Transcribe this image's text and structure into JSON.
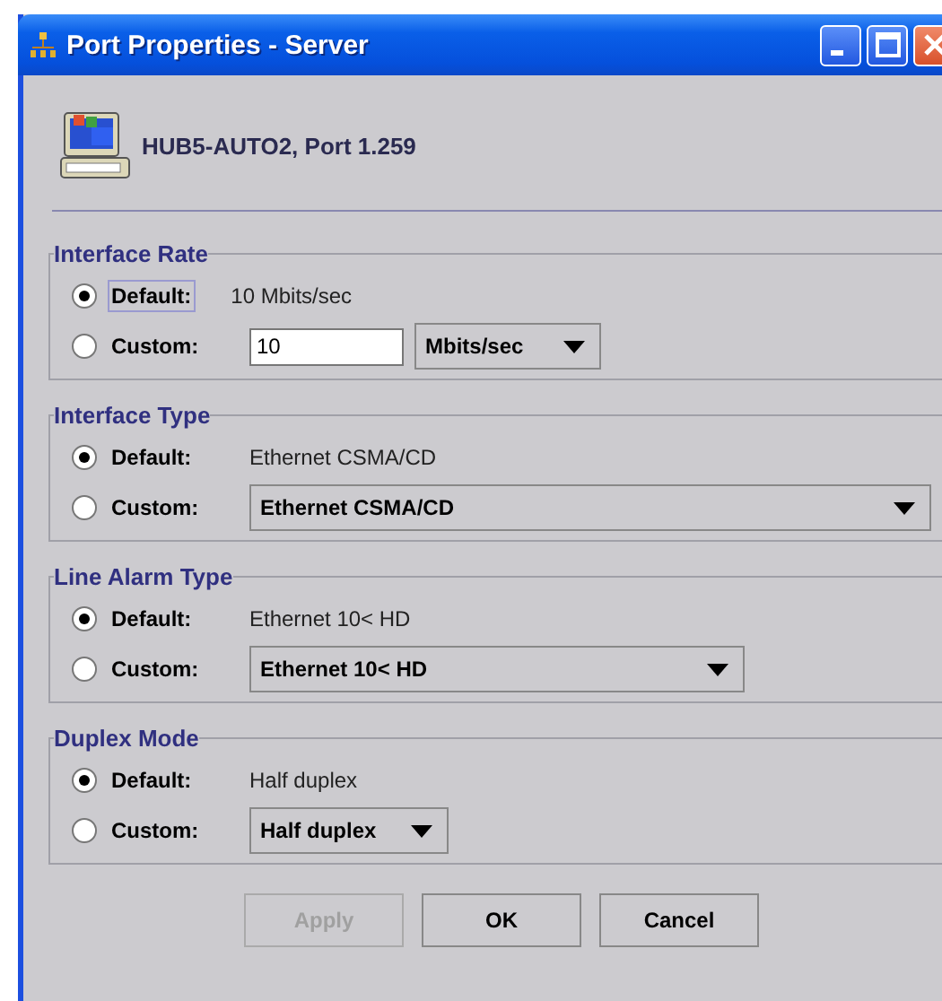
{
  "window": {
    "title": "Port Properties - Server"
  },
  "header": {
    "text": "HUB5-AUTO2, Port 1.259"
  },
  "sections": [
    {
      "title": "Interface Rate",
      "options": [
        {
          "kind": "default",
          "label": "Default:",
          "selected": true,
          "focused": true,
          "value": "10 Mbits/sec"
        },
        {
          "kind": "field_dropdown",
          "label": "Custom:",
          "selected": false,
          "field": "10",
          "dropdown": "Mbits/sec"
        }
      ]
    },
    {
      "title": "Interface Type",
      "options": [
        {
          "kind": "default",
          "label": "Default:",
          "selected": true,
          "focused": false,
          "value": "Ethernet CSMA/CD"
        },
        {
          "kind": "dropdown",
          "label": "Custom:",
          "selected": false,
          "dropdown": "Ethernet CSMA/CD"
        }
      ]
    },
    {
      "title": "Line Alarm Type",
      "options": [
        {
          "kind": "default",
          "label": "Default:",
          "selected": true,
          "focused": false,
          "value": "Ethernet 10< HD"
        },
        {
          "kind": "dropdown",
          "label": "Custom:",
          "selected": false,
          "dropdown": "Ethernet 10< HD"
        }
      ]
    },
    {
      "title": "Duplex Mode",
      "options": [
        {
          "kind": "default",
          "label": "Default:",
          "selected": true,
          "focused": false,
          "value": "Half duplex"
        },
        {
          "kind": "dropdown",
          "label": "Custom:",
          "selected": false,
          "dropdown": "Half duplex"
        }
      ]
    }
  ],
  "buttons": [
    {
      "label": "Apply",
      "disabled": true
    },
    {
      "label": "OK",
      "disabled": false
    },
    {
      "label": "Cancel",
      "disabled": false
    }
  ]
}
